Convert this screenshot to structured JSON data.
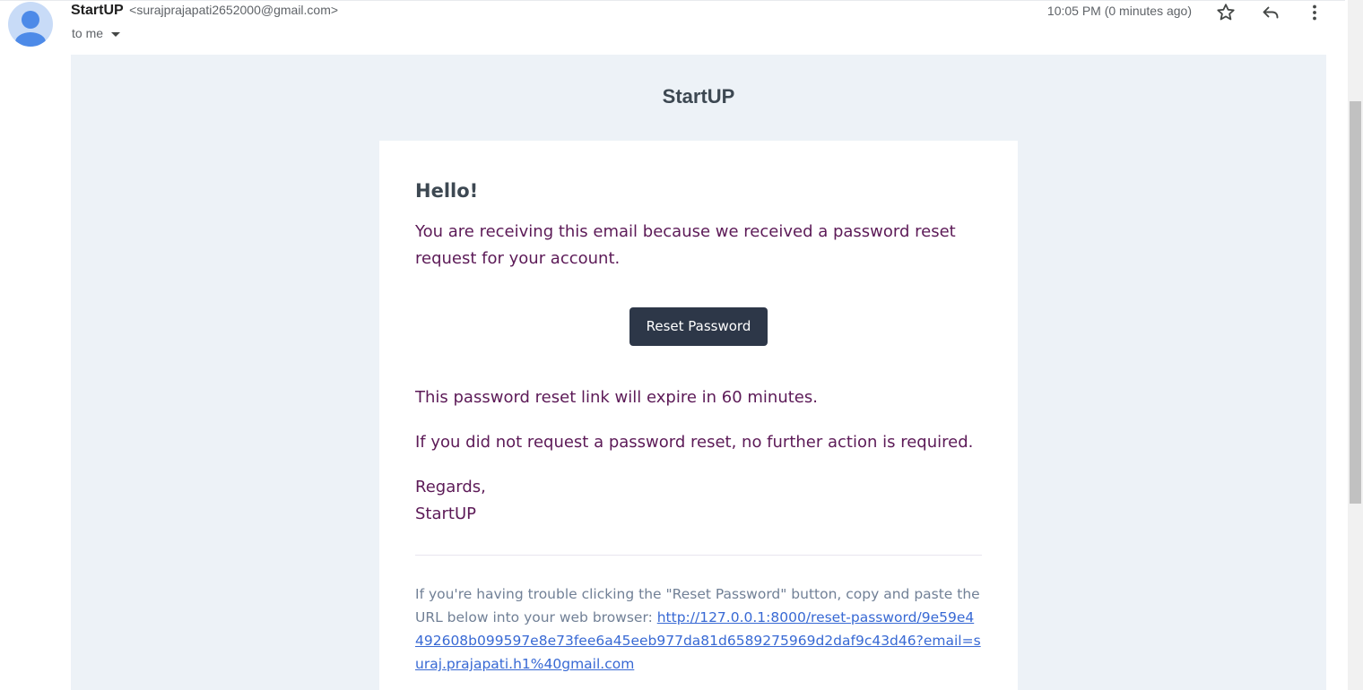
{
  "header": {
    "sender_name": "StartUP",
    "sender_email": "<surajprajapati2652000@gmail.com>",
    "recipient": "to me",
    "timestamp": "10:05 PM (0 minutes ago)",
    "icons": [
      "star-icon",
      "reply-icon",
      "more-vert-icon"
    ]
  },
  "email": {
    "brand": "StartUP",
    "greeting": "Hello!",
    "intro": "You are receiving this email because we received a password reset request for your account.",
    "button_label": "Reset Password",
    "expiry": "This password reset link will expire in 60 minutes.",
    "no_action": "If you did not request a password reset, no further action is required.",
    "regards": "Regards,",
    "signature": "StartUP",
    "subcopy_text": "If you're having trouble clicking the \"Reset Password\" button, copy and paste the URL below into your web browser: ",
    "reset_url": "http://127.0.0.1:8000/reset-password/9e59e4492608b099597e8e73fee6a45eeb977da81d6589275969d2daf9c43d46?email=suraj.prajapati.h1%40gmail.com"
  },
  "colors": {
    "email_background": "#edf2f7",
    "body_text": "#5c1a57",
    "button": "#2d3748",
    "link": "#3869d4",
    "subcopy": "#718096"
  }
}
